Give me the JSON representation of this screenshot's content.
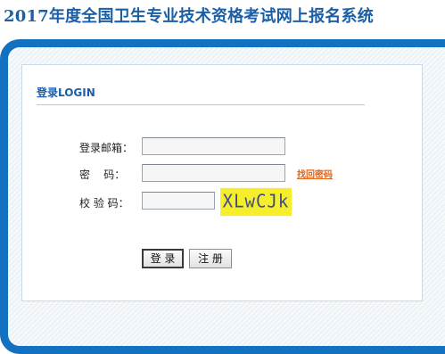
{
  "page": {
    "title": "2017年度全国卫生专业技术资格考试网上报名系统"
  },
  "login": {
    "heading": "登录LOGIN",
    "email_label": "登录邮箱：",
    "email_value": "",
    "password_label": "密    码：",
    "password_value": "",
    "retrieve_password": "找回密码",
    "captcha_label": "校 验 码：",
    "captcha_value": "",
    "captcha_text": "XLwCJk",
    "login_button": "登 录",
    "register_button": "注 册"
  },
  "colors": {
    "title": "#1b5fa6",
    "panel_border": "#1371c2",
    "captcha_bg": "#f6ee2a",
    "link": "#e0641a"
  }
}
